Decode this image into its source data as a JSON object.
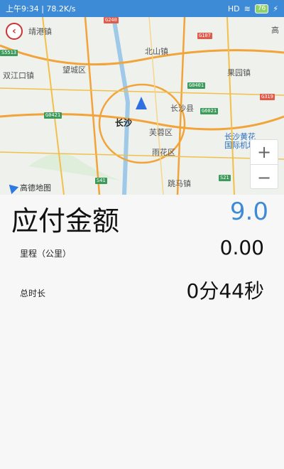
{
  "status": {
    "time_net": "上午9:34 | 78.2K/s",
    "right": "HD",
    "battery": "76"
  },
  "map": {
    "labels": {
      "jinggang": "靖港镇",
      "beishan": "北山镇",
      "wangcheng": "望城区",
      "guoyuan": "果园镇",
      "shuangjiang": "双江口镇",
      "changsha": "长沙",
      "changshaxian": "长沙县",
      "furong": "芙蓉区",
      "yuhua": "雨花区",
      "airport": "长沙黄花",
      "airport2": "国际机场",
      "tiaoma": "跳马镇",
      "gao": "高"
    },
    "shields": [
      "G240",
      "G107",
      "G0401",
      "G319",
      "S5513",
      "G0421",
      "G6021",
      "S41",
      "S21"
    ],
    "logo": "高德地图",
    "zoom_in": "+",
    "zoom_out": "−"
  },
  "fare": {
    "label": "应付金额",
    "value": "9.0"
  },
  "rows": {
    "distance_label": "里程（公里）",
    "distance_value": "0.00",
    "duration_label": "总时长",
    "duration_value": "0分44秒"
  },
  "colors": {
    "accent": "#3d8ad6",
    "back": "#cc3333"
  }
}
